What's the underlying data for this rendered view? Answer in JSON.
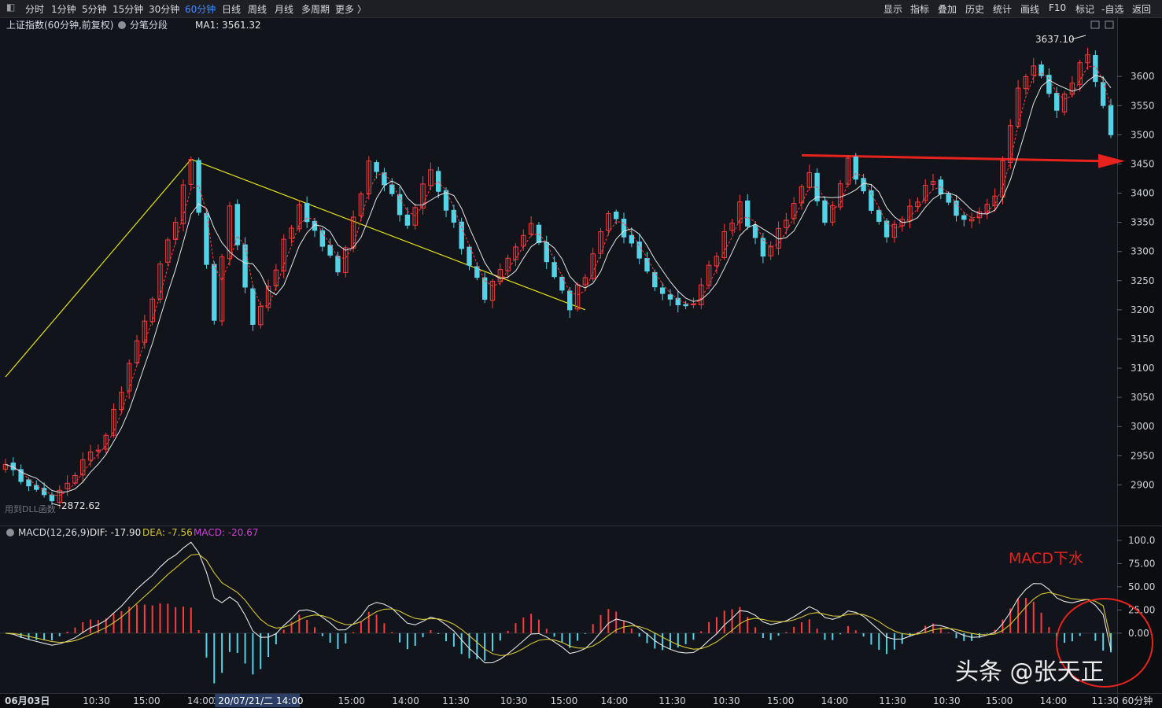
{
  "toolbar": {
    "periods": [
      "分时",
      "1分钟",
      "5分钟",
      "15分钟",
      "30分钟",
      "60分钟",
      "日线",
      "周线",
      "月线",
      "多周期",
      "更多 〉"
    ],
    "active_period": "60分钟",
    "tools": [
      "显示",
      "指标",
      "叠加",
      "历史",
      "统计",
      "画线",
      "F10",
      "标记",
      "-自选",
      "返回"
    ]
  },
  "chart_header": {
    "title": "上证指数(60分钟,前复权)",
    "mode": "分笔分段",
    "ma_label": "MA1: 3561.32"
  },
  "macd_header": {
    "name": "MACD(12,26,9)",
    "dif": "DIF: -17.90",
    "dea": "DEA: -7.56",
    "macd": "MACD: -20.67"
  },
  "annotations": {
    "high": "3637.10",
    "low": "2872.62",
    "dll_note": "用到DLL函数",
    "macd_note": "MACD下水",
    "watermark": "头条 @张天正"
  },
  "period_label": "60分钟",
  "colors": {
    "background": "#11141a",
    "up": "#ff3b3b",
    "down": "#54d2e6",
    "ma_line": "#e6e6e6",
    "trend_line": "#e6e615",
    "arrow": "#e8221c",
    "dea": "#d6c533"
  },
  "chart_data": [
    {
      "type": "candlestick",
      "title": "上证指数(60分钟,前复权)",
      "y_ticks": [
        3600,
        3550,
        3500,
        3450,
        3400,
        3350,
        3300,
        3250,
        3200,
        3150,
        3100,
        3050,
        3000,
        2950,
        2900
      ],
      "ylim": [
        2860,
        3665
      ],
      "x_ticks": [
        "06月03日",
        "10:30",
        "15:00",
        "14:00",
        "1:",
        "20/07/21/二 14:00",
        "15:00",
        "14:00",
        "11:30",
        "10:30",
        "15:00",
        "14:00",
        "11:30",
        "10:30",
        "15:00",
        "14:00",
        "11:30",
        "10:30",
        "15:00",
        "14:00",
        "11:30"
      ],
      "x_tick_positions": [
        0,
        10,
        16.5,
        23.5,
        26.8,
        27.5,
        43,
        50,
        56.5,
        64,
        70.5,
        77,
        84.5,
        91.5,
        98.5,
        105.5,
        113,
        120,
        126.8,
        133.8,
        140.5
      ],
      "swing_points": [
        {
          "i": 0,
          "v": 2935
        },
        {
          "i": 6,
          "v": 2872.62
        },
        {
          "i": 13,
          "v": 2985
        },
        {
          "i": 22,
          "v": 3350
        },
        {
          "i": 24,
          "v": 3458
        },
        {
          "i": 27,
          "v": 3182
        },
        {
          "i": 29,
          "v": 3378
        },
        {
          "i": 32,
          "v": 3175
        },
        {
          "i": 38,
          "v": 3380
        },
        {
          "i": 43,
          "v": 3265
        },
        {
          "i": 47,
          "v": 3455
        },
        {
          "i": 52,
          "v": 3345
        },
        {
          "i": 55,
          "v": 3440
        },
        {
          "i": 62,
          "v": 3218
        },
        {
          "i": 68,
          "v": 3348
        },
        {
          "i": 73,
          "v": 3200
        },
        {
          "i": 78,
          "v": 3365
        },
        {
          "i": 85,
          "v": 3228
        },
        {
          "i": 89,
          "v": 3210
        },
        {
          "i": 95,
          "v": 3385
        },
        {
          "i": 98,
          "v": 3292
        },
        {
          "i": 104,
          "v": 3435
        },
        {
          "i": 106,
          "v": 3350
        },
        {
          "i": 109,
          "v": 3460
        },
        {
          "i": 114,
          "v": 3325
        },
        {
          "i": 120,
          "v": 3420
        },
        {
          "i": 124,
          "v": 3355
        },
        {
          "i": 128,
          "v": 3395
        },
        {
          "i": 131,
          "v": 3580
        },
        {
          "i": 133,
          "v": 3618
        },
        {
          "i": 136,
          "v": 3542
        },
        {
          "i": 140,
          "v": 3637.1
        },
        {
          "i": 143,
          "v": 3500
        }
      ],
      "count": 144,
      "trend_lines": [
        {
          "from": {
            "i": 0,
            "v": 3085
          },
          "to": {
            "i": 24,
            "v": 3458
          }
        },
        {
          "from": {
            "i": 24,
            "v": 3458
          },
          "to": {
            "i": 75,
            "v": 3200
          }
        }
      ],
      "resistance_arrow": {
        "from": {
          "i": 103,
          "v": 3465
        },
        "to": {
          "i": 148,
          "v": 3455
        }
      }
    },
    {
      "type": "macd",
      "y_ticks": [
        100.0,
        75.0,
        50.0,
        25.0,
        0.0
      ],
      "y_tick_labels": [
        "100.0",
        "75.00",
        "50.00",
        "25.00",
        "0.00"
      ],
      "ylim": [
        -62,
        105
      ],
      "dif_last": -17.9,
      "dea_last": -7.56,
      "macd_last": -20.67
    }
  ]
}
